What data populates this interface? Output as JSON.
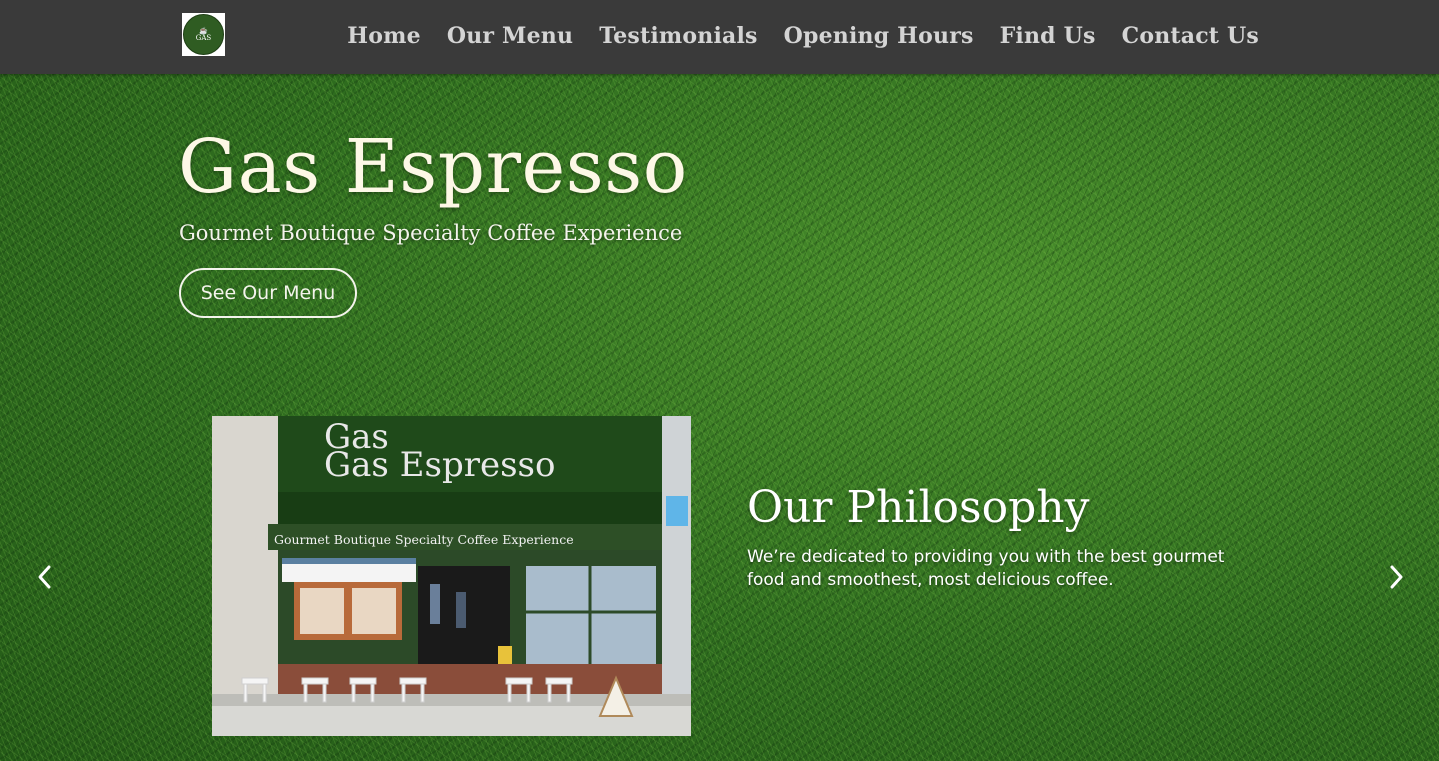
{
  "header": {
    "logo_text": "Gas Espresso",
    "nav": [
      {
        "label": "Home"
      },
      {
        "label": "Our Menu"
      },
      {
        "label": "Testimonials"
      },
      {
        "label": "Opening Hours"
      },
      {
        "label": "Find Us"
      },
      {
        "label": "Contact Us"
      }
    ]
  },
  "hero": {
    "title": "Gas Espresso",
    "subtitle": "Gourmet Boutique Specialty Coffee Experience",
    "button_label": "See Our Menu"
  },
  "slider": {
    "photo": {
      "sign_title": "Gas Espresso",
      "sign_tagline": "Gourmet Boutique Specialty Coffee Experience"
    },
    "heading": "Our Philosophy",
    "text": "We’re dedicated to providing you with the best gourmet food and smoothest, most delicious coffee.",
    "prev_icon": "chevron-left-icon",
    "next_icon": "chevron-right-icon"
  },
  "colors": {
    "header_bg": "#3a3a3a",
    "nav_text": "#d4d4d4",
    "hero_text": "#fdf8e6",
    "grass": "#2f6d1f"
  }
}
